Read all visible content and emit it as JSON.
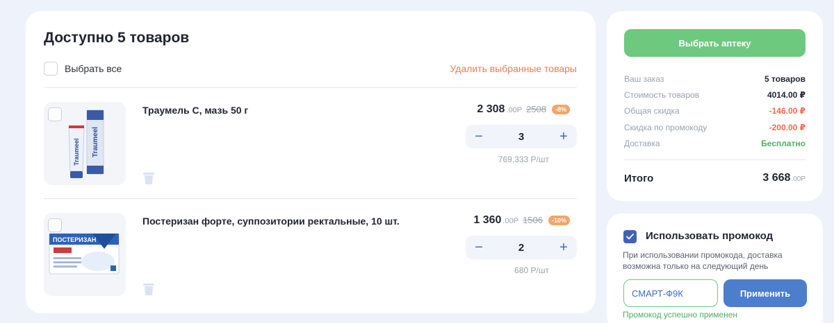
{
  "cart": {
    "title": "Доступно 5 товаров",
    "select_all_label": "Выбрать все",
    "delete_selected_label": "Удалить выбранные товары",
    "items": [
      {
        "name": "Траумель С, мазь 50 г",
        "price_main": "2 308",
        "price_kop": ".00Р",
        "price_old": "2508",
        "discount_badge": "-8%",
        "quantity": "3",
        "per_unit": "769.333 Р/шт",
        "product_label": "Traumeel"
      },
      {
        "name": "Постеризан форте, суппозитории ректальные, 10 шт.",
        "price_main": "1 360",
        "price_kop": ".00Р",
        "price_old": "1506",
        "discount_badge": "-10%",
        "quantity": "2",
        "per_unit": "680 Р/шт",
        "product_label": "ПОСТЕРИЗАН"
      }
    ],
    "decrement_symbol": "−",
    "increment_symbol": "+"
  },
  "summary": {
    "choose_pharmacy_label": "Выбрать аптеку",
    "rows": [
      {
        "label": "Ваш заказ",
        "value": "5 товаров"
      },
      {
        "label": "Стоимость товаров",
        "value": "4014.00 ₽"
      },
      {
        "label": "Общая скидка",
        "value": "-146.00 ₽"
      },
      {
        "label": "Скидка по промокоду",
        "value": "-200.00 ₽"
      },
      {
        "label": "Доставка",
        "value": "Бесплатно"
      }
    ],
    "total_label": "Итого",
    "total_main": "3 668",
    "total_kop": ".00Р"
  },
  "promo": {
    "checked": true,
    "title": "Использовать промокод",
    "note": "При использовании промокода, доставка возможна только на следующий день",
    "code_value": "СМАРТ-Ф9К",
    "apply_label": "Применить",
    "success_text": "Промокод успешно применен"
  },
  "colors": {
    "background": "#eef2fb",
    "accent_green": "#6dc97e",
    "accent_blue": "#4d7dcd",
    "danger": "#f06a4c",
    "link_orange": "#f07a55",
    "badge_orange": "#f4a466"
  },
  "icons": [
    "trash-icon",
    "minus-icon",
    "plus-icon",
    "checkmark-icon"
  ]
}
